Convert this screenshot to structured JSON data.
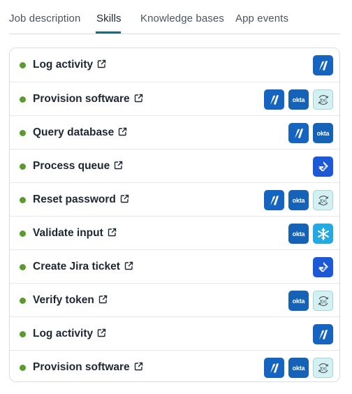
{
  "tabs": [
    {
      "label": "Job description",
      "active": false
    },
    {
      "label": "Skills",
      "active": true
    },
    {
      "label": "Knowledge bases",
      "active": false
    },
    {
      "label": "App events",
      "active": false
    }
  ],
  "skills": [
    {
      "name": "Log activity",
      "status_color": "#5c9a2c",
      "apps": [
        "brand-app-icon"
      ]
    },
    {
      "name": "Provision software",
      "status_color": "#5c9a2c",
      "apps": [
        "brand-app-icon",
        "okta-icon",
        "cycle-app-icon"
      ]
    },
    {
      "name": "Query database",
      "status_color": "#5c9a2c",
      "apps": [
        "brand-app-icon",
        "okta-icon"
      ]
    },
    {
      "name": "Process queue",
      "status_color": "#5c9a2c",
      "apps": [
        "jira-icon"
      ]
    },
    {
      "name": "Reset password",
      "status_color": "#5c9a2c",
      "apps": [
        "brand-app-icon",
        "okta-icon",
        "cycle-app-icon"
      ]
    },
    {
      "name": "Validate input",
      "status_color": "#5c9a2c",
      "apps": [
        "okta-icon",
        "snowflake-icon"
      ]
    },
    {
      "name": "Create Jira ticket",
      "status_color": "#5c9a2c",
      "apps": [
        "jira-icon"
      ]
    },
    {
      "name": "Verify token",
      "status_color": "#5c9a2c",
      "apps": [
        "okta-icon",
        "cycle-app-icon"
      ]
    },
    {
      "name": "Log activity",
      "status_color": "#5c9a2c",
      "apps": [
        "brand-app-icon"
      ]
    },
    {
      "name": "Provision software",
      "status_color": "#5c9a2c",
      "apps": [
        "brand-app-icon",
        "okta-icon",
        "cycle-app-icon"
      ]
    }
  ],
  "okta_text": "okta",
  "colors": {
    "accent": "#1b6b7a",
    "status_active": "#5c9a2c"
  }
}
